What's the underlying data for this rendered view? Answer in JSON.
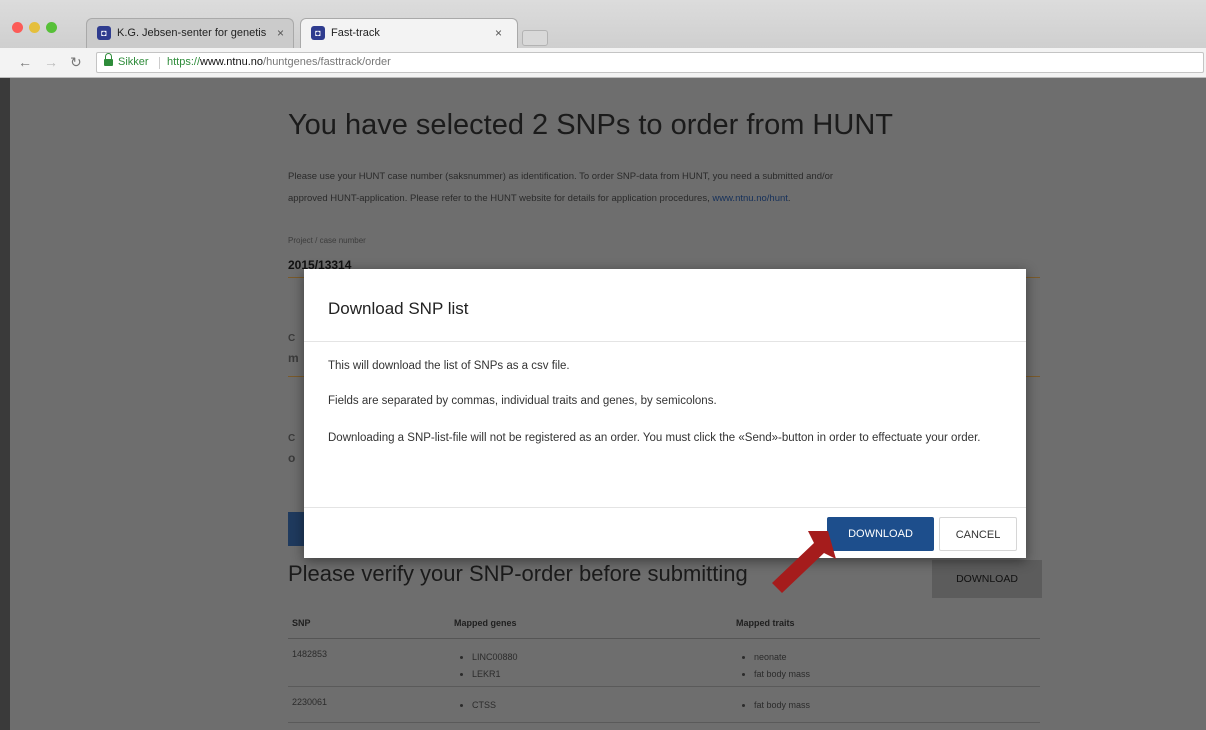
{
  "browser": {
    "tabs": [
      {
        "title": "K.G. Jebsen-senter for genetis",
        "favicon": "NTNU-icon"
      },
      {
        "title": "Fast-track",
        "favicon": "NTNU-icon"
      }
    ],
    "close_glyph": "×",
    "address": {
      "security_label": "Sikker",
      "scheme": "https://",
      "host": "www.ntnu.no",
      "path": "/huntgenes/fasttrack/order"
    }
  },
  "page": {
    "heading": "You have selected 2 SNPs to order from HUNT",
    "intro_line1": "Please use your HUNT case number (saksnummer) as identification. To order SNP-data from HUNT, you need a submitted and/or",
    "intro_line2_text": "approved HUNT-application. Please refer to the HUNT website for details for application procedures,",
    "intro_link": "www.ntnu.no/hunt",
    "project_label": "Project / case number",
    "project_value": "2015/13314",
    "verify_heading": "Please verify your SNP-order before submitting",
    "download_button": "DOWNLOAD",
    "table": {
      "headers": [
        "SNP",
        "Mapped genes",
        "Mapped traits"
      ],
      "rows": [
        {
          "snp": "1482853",
          "genes": [
            "LINC00880",
            "LEKR1"
          ],
          "traits": [
            "neonate",
            "fat body mass"
          ]
        },
        {
          "snp": "2230061",
          "genes": [
            "CTSS"
          ],
          "traits": [
            "fat body mass"
          ]
        }
      ]
    }
  },
  "modal": {
    "title": "Download SNP list",
    "paragraphs": [
      "This will download the list of SNPs as a csv file.",
      "Fields are separated by commas, individual traits and genes, by semicolons.",
      "Downloading a SNP-list-file will not be registered as an order. You must click the «Send»-button in order to effectuate your order."
    ],
    "download_label": "DOWNLOAD",
    "cancel_label": "CANCEL"
  },
  "colors": {
    "primary_button": "#1d4e8c",
    "annotation_arrow": "#a51c1c",
    "secure_green": "#2e8c3a"
  }
}
